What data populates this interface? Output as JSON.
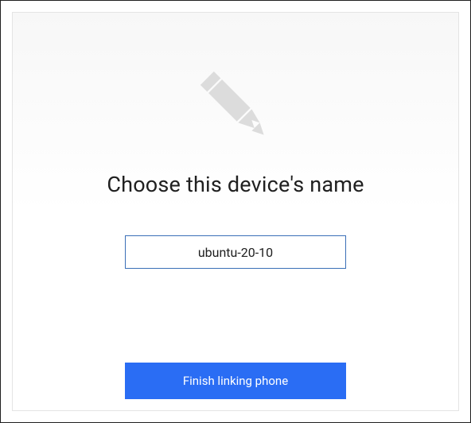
{
  "dialog": {
    "heading": "Choose this device's name",
    "device_name_value": "ubuntu-20-10",
    "finish_button_label": "Finish linking phone",
    "icon": "pencil-icon"
  },
  "colors": {
    "accent": "#2a6df4",
    "input_border": "#3a6fb7",
    "icon_fill": "#dcdcdc"
  }
}
